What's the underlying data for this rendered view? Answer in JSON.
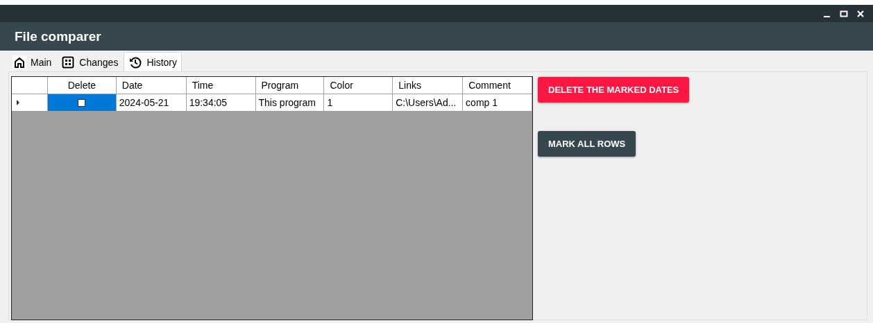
{
  "window": {
    "title": "File comparer"
  },
  "tabs": [
    {
      "label": "Main",
      "kind": "home",
      "selected": false
    },
    {
      "label": "Changes",
      "kind": "grid",
      "selected": false
    },
    {
      "label": "History",
      "kind": "history",
      "selected": true
    }
  ],
  "table": {
    "columns": [
      "Delete",
      "Date",
      "Time",
      "Program",
      "Color",
      "Links",
      "Comment"
    ],
    "rows": [
      {
        "selected": true,
        "cells": [
          {
            "kind": "checkbox",
            "checked": false
          },
          {
            "kind": "text",
            "text": "2024-05-21"
          },
          {
            "kind": "text",
            "text": "19:34:05"
          },
          {
            "kind": "text",
            "text": "This program"
          },
          {
            "kind": "text",
            "text": "1"
          },
          {
            "kind": "text",
            "text": "C:\\Users\\Ad..."
          },
          {
            "kind": "text",
            "text": "comp 1"
          }
        ]
      }
    ]
  },
  "buttons": [
    {
      "label": "DELETE THE MARKED DATES",
      "kind": "danger"
    },
    {
      "label": "MARK ALL ROWS",
      "kind": "dark"
    }
  ]
}
